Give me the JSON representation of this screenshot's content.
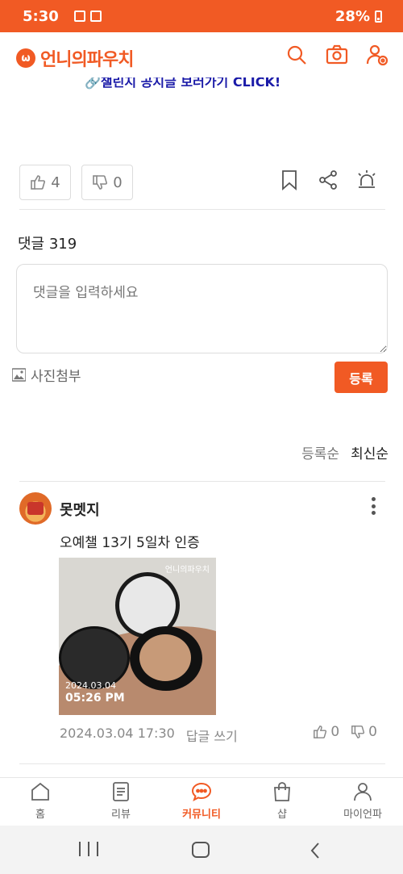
{
  "status_bar": {
    "time": "5:30",
    "battery": "28%"
  },
  "header": {
    "logo_text": "언니의파우치",
    "logo_icon": "pouch-logo-icon",
    "icons": [
      "search-icon",
      "camera-icon",
      "profile-settings-icon"
    ]
  },
  "banner": {
    "text": "🔗챌린지 공지글 보러가기 CLICK!"
  },
  "reactions": {
    "like_count": "4",
    "dislike_count": "0"
  },
  "comments_section": {
    "label": "댓글 319",
    "input_placeholder": "댓글을 입력하세요",
    "photo_attach_label": "사진첨부",
    "submit_label": "등록",
    "sort_options": [
      "등록순",
      "최신순"
    ]
  },
  "comment": {
    "author": "못멧지",
    "text": "오예챌 13기 5일차 인증",
    "photo": {
      "watermark": "언니의파우치",
      "date": "2024.03.04",
      "time": "05:26 PM"
    },
    "timestamp": "2024.03.04 17:30",
    "reply_label": "답글 쓰기",
    "likes": "0",
    "dislikes": "0"
  },
  "bottom_nav": [
    {
      "label": "홈",
      "icon": "home-icon"
    },
    {
      "label": "리뷰",
      "icon": "review-icon"
    },
    {
      "label": "커뮤니티",
      "icon": "community-icon",
      "active": true
    },
    {
      "label": "샵",
      "icon": "shop-icon"
    },
    {
      "label": "마이언파",
      "icon": "my-icon"
    }
  ],
  "colors": {
    "accent": "#f15a24"
  }
}
